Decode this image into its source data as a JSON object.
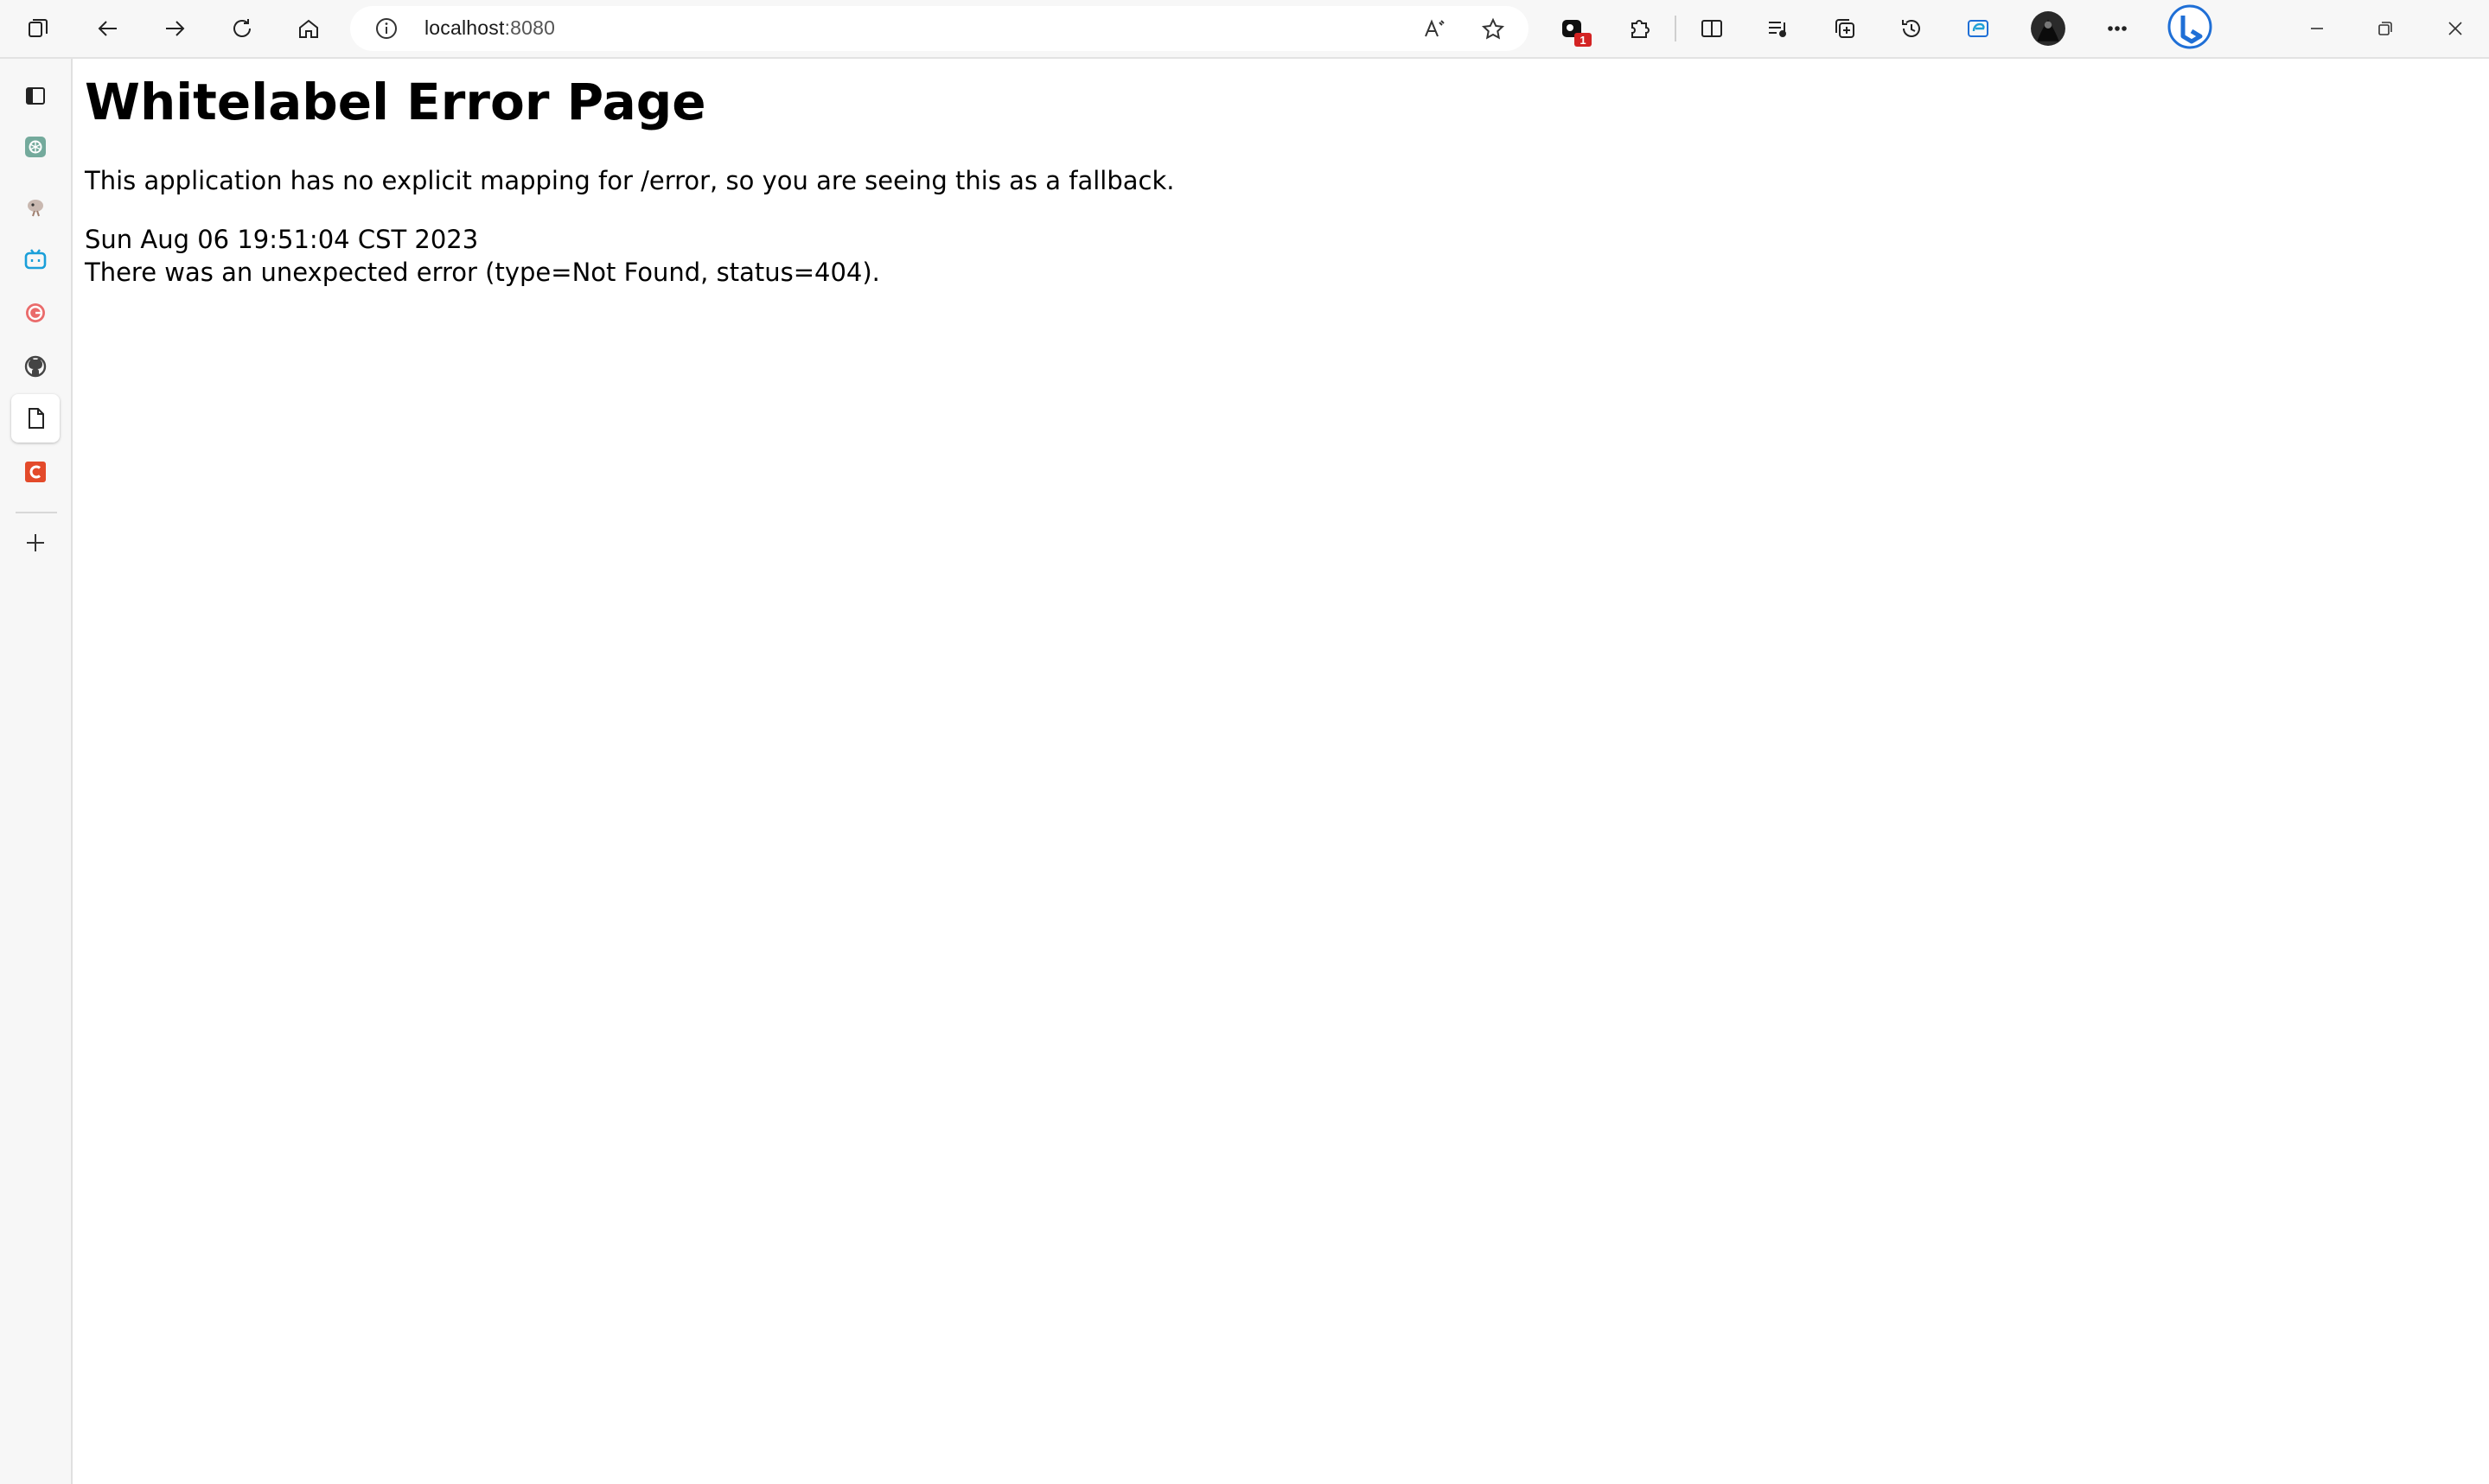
{
  "browser": {
    "url_host": "localhost",
    "url_port": ":8080",
    "extensions_badge": "1",
    "toolbar_icons": [
      "tab-actions-icon",
      "back-arrow-icon",
      "forward-arrow-icon",
      "refresh-icon",
      "home-icon",
      "site-info-icon",
      "read-aloud-icon",
      "favorite-star-icon",
      "extension-badge-icon",
      "extensions-puzzle-icon",
      "split-screen-icon",
      "favorites-list-icon",
      "collections-icon",
      "history-icon",
      "edge-icon",
      "profile-avatar-icon",
      "more-menu-icon",
      "bing-copilot-icon"
    ],
    "sidebar_icons": [
      "vertical-tabs-icon",
      "chatgpt-icon",
      "bird-icon",
      "bilibili-icon",
      "red-g-icon",
      "github-icon",
      "document-icon",
      "c-app-icon",
      "add-icon"
    ],
    "colors": {
      "chrome_bg": "#f7f7f7",
      "badge": "#d32323",
      "bing_blue": "#1f6fd6"
    }
  },
  "page": {
    "title": "Whitelabel Error Page",
    "message": "This application has no explicit mapping for /error, so you are seeing this as a fallback.",
    "timestamp": "Sun Aug 06 19:51:04 CST 2023",
    "error": "There was an unexpected error (type=Not Found, status=404)."
  }
}
